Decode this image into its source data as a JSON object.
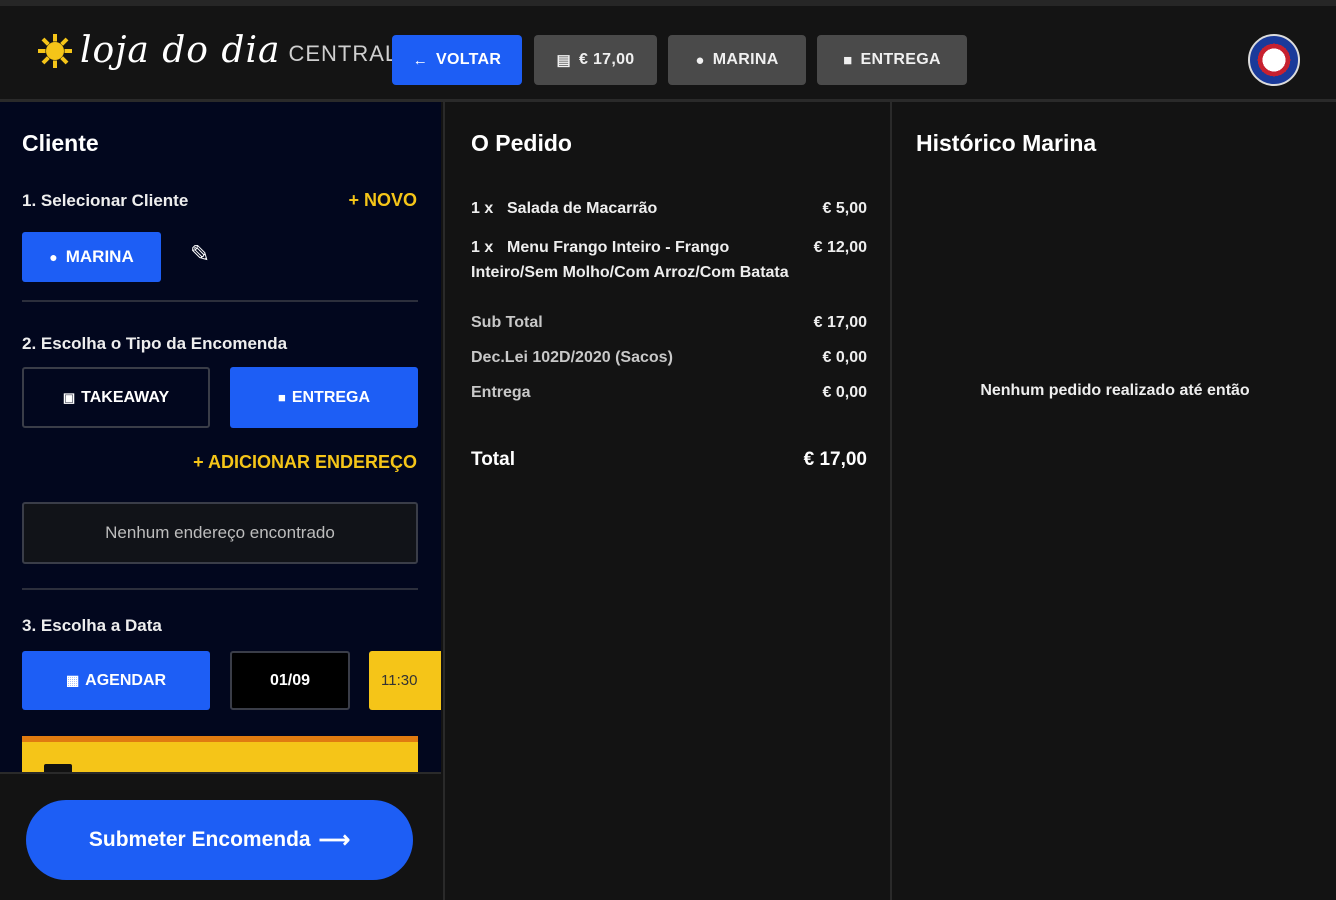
{
  "header": {
    "logo_text": "loja do dia",
    "logo_suffix": "CENTRAL",
    "back_label": "VOLTAR",
    "total_label": "€ 17,00",
    "client_label": "MARINA",
    "delivery_label": "ENTREGA",
    "icons": {
      "back": "arrow-left-icon",
      "total": "receipt-icon",
      "client": "person-icon",
      "delivery": "truck-icon"
    }
  },
  "client_panel": {
    "title": "Cliente",
    "step1": "1. Selecionar Cliente",
    "new_link": "+ NOVO",
    "selected_client": "MARINA",
    "step2": "2. Escolha o Tipo da Encomenda",
    "type_takeaway": "TAKEAWAY",
    "type_delivery": "ENTREGA",
    "add_address_link": "+ ADICIONAR  ENDEREÇO",
    "no_address": "Nenhum endereço encontrado",
    "step3": "3. Escolha a Data",
    "schedule_label": "AGENDAR",
    "date_value": "01/09",
    "time_value": "11:30",
    "submit_label": "Submeter Encomenda"
  },
  "order_panel": {
    "title": "O Pedido",
    "items": [
      {
        "qty": "1  x",
        "name": "Salada de Macarrão",
        "detail": "",
        "price": "€ 5,00"
      },
      {
        "qty": "1  x",
        "name": "Menu Frango Inteiro - Frango",
        "detail": "Inteiro/Sem Molho/Com Arroz/Com Batata",
        "price": "€ 12,00"
      }
    ],
    "subtotal_label": "Sub Total",
    "subtotal_value": "€ 17,00",
    "bags_label": "Dec.Lei 102D/2020 (Sacos)",
    "bags_value": "€ 0,00",
    "delivery_label": "Entrega",
    "delivery_value": "€ 0,00",
    "total_label": "Total",
    "total_value": "€ 17,00"
  },
  "history_panel": {
    "title": "Histórico Marina",
    "empty_message": "Nenhum pedido realizado até então"
  },
  "colors": {
    "accent_blue": "#1d5ef5",
    "accent_yellow": "#f5c518",
    "left_panel_bg": "#02071e",
    "dark_bg": "#131313"
  }
}
